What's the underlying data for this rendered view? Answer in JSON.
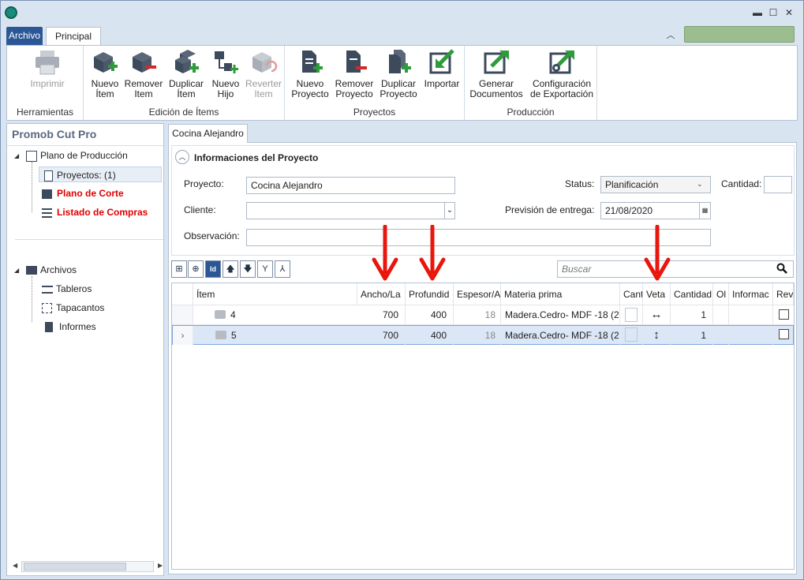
{
  "window": {
    "min": "▬",
    "max": "☐",
    "close": "✕"
  },
  "tabs": {
    "archivo": "Archivo",
    "principal": "Principal"
  },
  "ribbon": {
    "groups": {
      "herramientas": "Herramientas",
      "edicion": "Edición de Ítems",
      "proyectos": "Proyectos",
      "produccion": "Producción"
    },
    "buttons": {
      "imprimir": "Imprimir",
      "nuevo_item_1": "Nuevo",
      "nuevo_item_2": "Ítem",
      "remover_item_1": "Remover",
      "remover_item_2": "Item",
      "duplicar_item_1": "Duplicar",
      "duplicar_item_2": "Ítem",
      "nuevo_hijo_1": "Nuevo",
      "nuevo_hijo_2": "Hijo",
      "revertir_item_1": "Reverter",
      "revertir_item_2": "Item",
      "nuevo_proyecto_1": "Nuevo",
      "nuevo_proyecto_2": "Proyecto",
      "remover_proyecto_1": "Remover",
      "remover_proyecto_2": "Proyecto",
      "duplicar_proyecto_1": "Duplicar",
      "duplicar_proyecto_2": "Proyecto",
      "importar": "Importar",
      "generar_1": "Generar",
      "generar_2": "Documentos",
      "config_1": "Configuración",
      "config_2": "de Exportación"
    }
  },
  "sidebar": {
    "title": "Promob Cut Pro",
    "plano_produccion": "Plano de Producción",
    "proyectos": "Proyectos: (1)",
    "plano_corte": "Plano de Corte",
    "listado_compras": "Listado de Compras",
    "archivos": "Archivos",
    "tableros": "Tableros",
    "tapacantos": "Tapacantos",
    "informes": "Informes"
  },
  "doc_tab": "Cocina Alejandro",
  "info": {
    "section_title": "Informaciones del Proyecto",
    "proyecto_label": "Proyecto:",
    "proyecto_value": "Cocina Alejandro",
    "cliente_label": "Cliente:",
    "cliente_value": "",
    "observacion_label": "Observación:",
    "observacion_value": "",
    "status_label": "Status:",
    "status_value": "Planificación",
    "prevision_label": "Previsión de entrega:",
    "prevision_value": "21/08/2020",
    "cantidad_label": "Cantidad:"
  },
  "search": {
    "placeholder": "Buscar"
  },
  "grid": {
    "headers": [
      "Ítem",
      "Ancho/La",
      "Profundid",
      "Espesor/A",
      "Materia prima",
      "Cant",
      "Veta",
      "Cantidad",
      "Ol",
      "Informac",
      "Rev"
    ],
    "rows": [
      {
        "item": "4",
        "ancho": "700",
        "profundidad": "400",
        "espesor": "18",
        "materia": "Madera.Cedro- MDF -18 (2",
        "veta": "↔",
        "cantidad": "1"
      },
      {
        "item": "5",
        "ancho": "700",
        "profundidad": "400",
        "espesor": "18",
        "materia": "Madera.Cedro- MDF -18 (2",
        "veta": "↕",
        "cantidad": "1"
      }
    ]
  },
  "colors": {
    "accent": "#2b5797",
    "ribbon_icon": "#3c4a5c",
    "green": "#2e9c3a",
    "red_arrow": "#e8160c",
    "red_text": "#e00000"
  }
}
